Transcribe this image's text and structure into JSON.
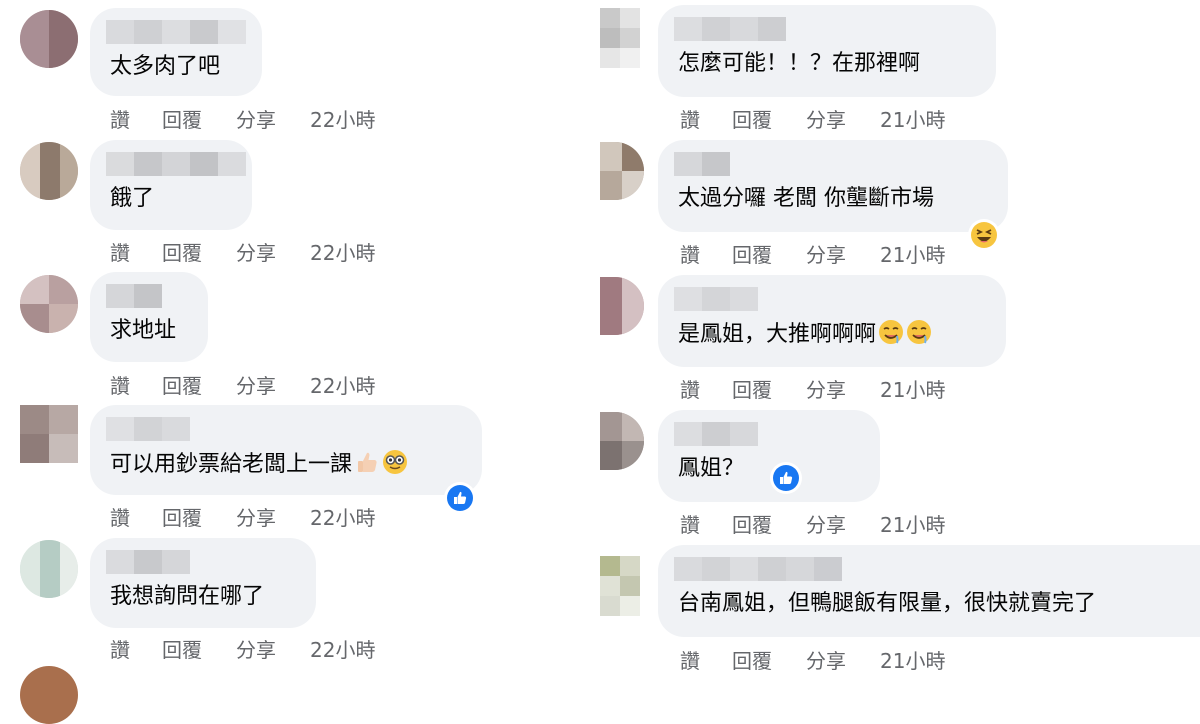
{
  "actions": {
    "like": "讚",
    "reply": "回覆",
    "share": "分享"
  },
  "left_comments": [
    {
      "text": "太多肉了吧",
      "time": "22小時"
    },
    {
      "text": "餓了",
      "time": "22小時"
    },
    {
      "text": "求地址",
      "time": "22小時"
    },
    {
      "text": "可以用鈔票給老闆上一課",
      "time": "22小時",
      "inline_emojis": [
        "thumbs-up-icon",
        "nerd-face-icon"
      ],
      "reaction": "like-icon"
    },
    {
      "text": "我想詢問在哪了",
      "time": "22小時"
    }
  ],
  "right_comments": [
    {
      "text": "怎麼可能！！？在那裡啊",
      "time": "21小時"
    },
    {
      "text": "太過分囉 老闆 你壟斷市場",
      "time": "21小時",
      "reaction": "laughing-face-icon"
    },
    {
      "text": "是鳳姐，大推啊啊啊",
      "time": "21小時",
      "inline_emojis": [
        "drooling-face-icon",
        "drooling-face-icon"
      ]
    },
    {
      "text": "鳳姐？",
      "time": "21小時",
      "reaction": "like-icon"
    },
    {
      "text": "台南鳳姐，但鴨腿飯有限量，很快就賣完了",
      "time": "21小時"
    }
  ],
  "colors": {
    "bubble": "#f0f2f5",
    "meta_text": "#65676b",
    "like_blue": "#1877f2",
    "reaction_yellow": "#f7c53f"
  }
}
